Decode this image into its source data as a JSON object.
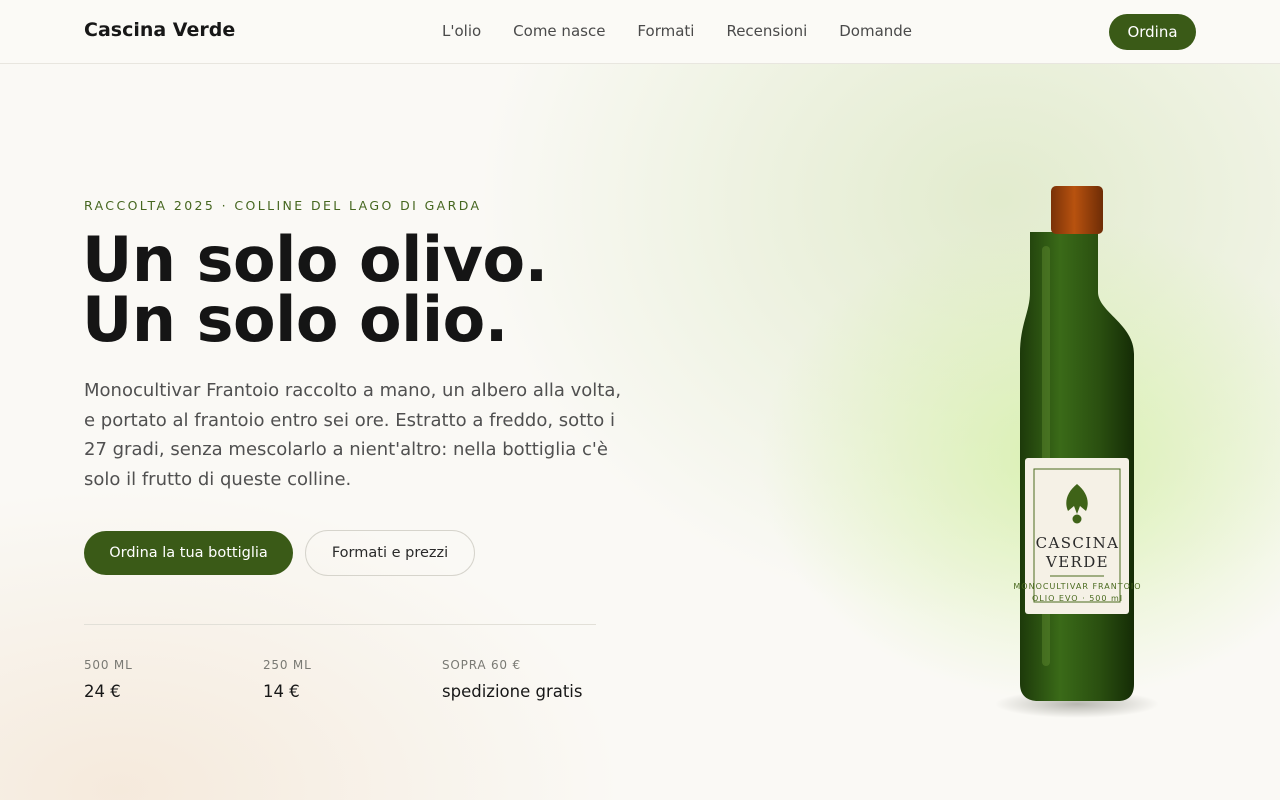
{
  "brand": {
    "name": "Cascina Verde"
  },
  "nav": {
    "items": [
      "L'olio",
      "Come nasce",
      "Formati",
      "Recensioni",
      "Domande"
    ],
    "order_label": "Ordina"
  },
  "hero": {
    "eyebrow": "RACCOLTA 2025 · COLLINE DEL LAGO DI GARDA",
    "title_line1": "Un solo olivo.",
    "title_line2": "Un solo olio.",
    "lead": "Monocultivar Frantoio raccolto a mano, un albero alla volta, e portato al frantoio entro sei ore. Estratto a freddo, sotto i 27 gradi, senza mescolarlo a nient'altro: nella bottiglia c'è solo il frutto di queste colline.",
    "cta_primary": "Ordina la tua bottiglia",
    "cta_secondary": "Formati e prezzi"
  },
  "stats": [
    {
      "label": "500 ML",
      "value": "24 €"
    },
    {
      "label": "250 ML",
      "value": "14 €"
    },
    {
      "label": "SOPRA 60 €",
      "value": "spedizione gratis"
    }
  ],
  "bottle_label": {
    "brand_line1": "CASCINA",
    "brand_line2": "VERDE",
    "sub_line1": "MONOCULTIVAR FRANTOIO",
    "sub_line2": "OLIO EVO · 500 ml"
  },
  "colors": {
    "accent": "#3a5a17",
    "eyebrow": "#45661f",
    "bottle": "#2d5212",
    "cap": "#a8490e"
  }
}
